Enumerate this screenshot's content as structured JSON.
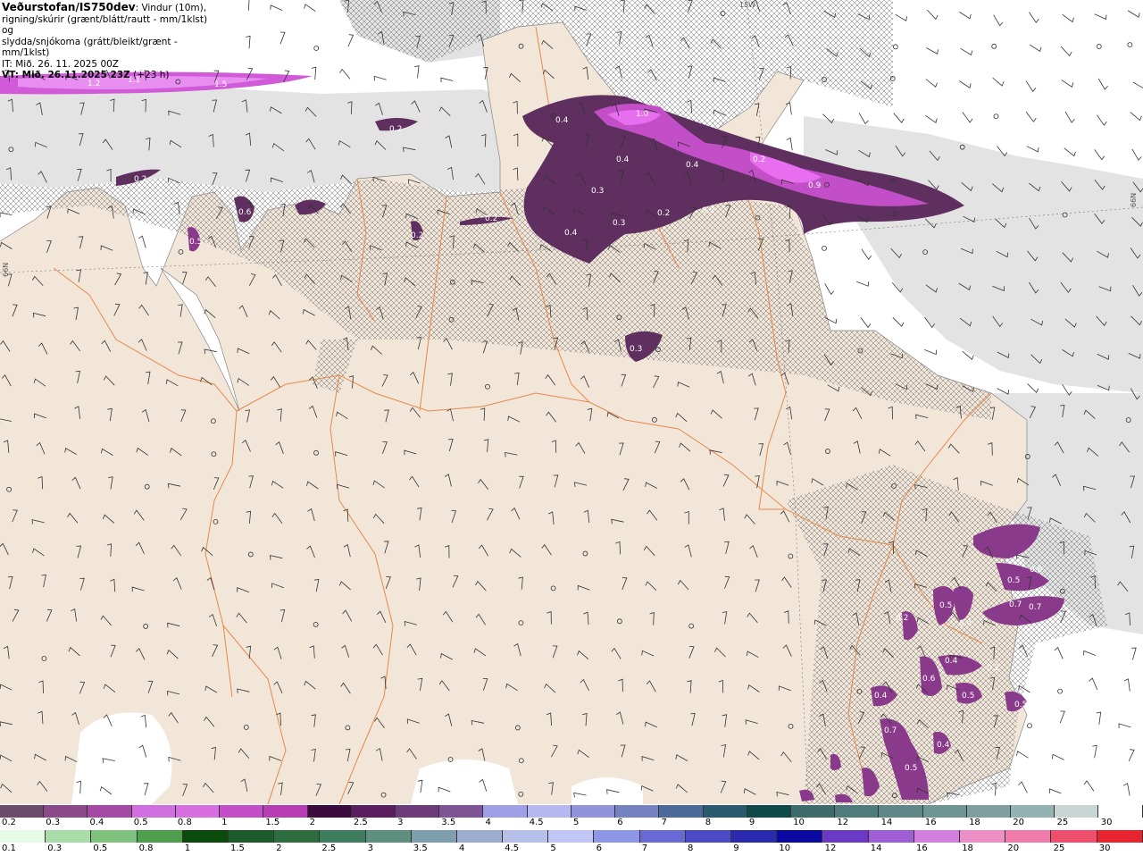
{
  "header": {
    "title": "Veðurstofan/IS750dev",
    "desc1": ": Vindur (10m),",
    "desc2": "rigning/skúrir (grænt/blátt/rautt - mm/1klst) og",
    "desc3": "slydda/snjókoma (grátt/bleikt/grænt - mm/1klst)",
    "it": "IT: Mið. 26. 11. 2025 00Z",
    "vt": "VT: Mið. 26.11.2025 23Z",
    "vt_offset": " (+23 h)"
  },
  "grid_labels": {
    "lon": "15W",
    "lat_right": "66N",
    "lat_left": "66N"
  },
  "contour_labels": [
    "1.2",
    "1.1",
    "1.5",
    "0.2",
    "0.2",
    "0.4",
    "1.0",
    "0.4",
    "0.4",
    "0.3",
    "0.9",
    "0.3",
    "0.2",
    "0.2",
    "0.6",
    "0.5",
    "0.2",
    "0.2",
    "0.4",
    "0.3",
    "0.2",
    "0.8",
    "0.5",
    "0.7",
    "0.7",
    "0.2",
    "0.4",
    "0.5",
    "0.4",
    "0.7",
    "0.5",
    "0.5",
    "0.4",
    "0.2",
    "0.5",
    "0.4",
    "0.6"
  ],
  "legend_top": {
    "labels": [
      "0.2",
      "0.3",
      "0.4",
      "0.5",
      "0.8",
      "1",
      "1.5",
      "2",
      "2.5",
      "3",
      "3.5",
      "4",
      "4.5",
      "5",
      "6",
      "7",
      "8",
      "9",
      "10",
      "12",
      "14",
      "16",
      "18",
      "20",
      "25",
      "30"
    ],
    "colors": [
      "#6b4a6b",
      "#8a4a8a",
      "#a44aa4",
      "#cf6fe0",
      "#d86ee2",
      "#c24fc7",
      "#b83cb5",
      "#3c0a3c",
      "#5a1e5e",
      "#6d3b7a",
      "#7e5494",
      "#9e9fe6",
      "#b7b7f2",
      "#8f94db",
      "#7583c2",
      "#4b6a9a",
      "#2a5a70",
      "#0f4a4a",
      "#3d6a6a",
      "#4e7b7b",
      "#5f8686",
      "#6f9494",
      "#7f9f9f",
      "#93b2b2",
      "#c9d4d4",
      "#ffffff"
    ]
  },
  "legend_bottom": {
    "labels": [
      "0.1",
      "0.3",
      "0.5",
      "0.8",
      "1",
      "1.5",
      "2",
      "2.5",
      "3",
      "3.5",
      "4",
      "4.5",
      "5",
      "6",
      "7",
      "8",
      "9",
      "10",
      "12",
      "14",
      "16",
      "18",
      "20",
      "25",
      "30"
    ],
    "colors": [
      "#e6fbe6",
      "#a8dca8",
      "#7ec27e",
      "#4e9e4e",
      "#0a4a0a",
      "#1c5c2c",
      "#2e6e3e",
      "#3e7e5e",
      "#5e8e7e",
      "#7e9eae",
      "#9eaece",
      "#b6beea",
      "#c2c6f6",
      "#8e96e6",
      "#6a6ad6",
      "#4a4ac6",
      "#2a2ab0",
      "#0a0aa0",
      "#6a3ac6",
      "#a05ed6",
      "#d27ede",
      "#ee8ec6",
      "#f07aaa",
      "#f04e6e",
      "#e8242e"
    ]
  },
  "colors": {
    "land": "#f2e6d9",
    "snow_light": "#e3e3e3",
    "snow_purple": "#5f2f5f",
    "snow_magenta": "#e86ef0",
    "roads": "#e8884a",
    "barbs": "#333333"
  }
}
